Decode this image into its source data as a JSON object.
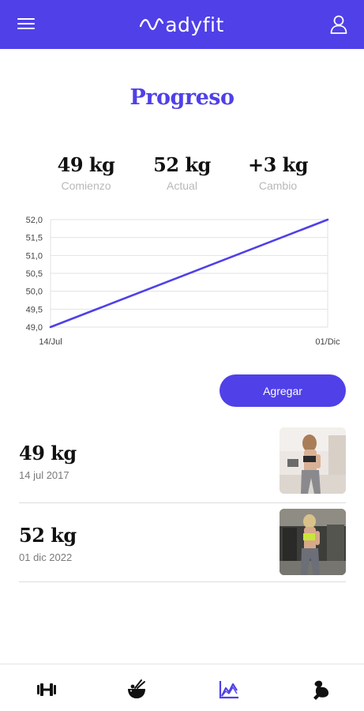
{
  "header": {
    "brand_name": "adyfit",
    "menu_icon": "hamburger-menu-icon",
    "profile_icon": "user-profile-icon",
    "brand_color": "#5040e8"
  },
  "page": {
    "title": "Progreso"
  },
  "stats": [
    {
      "value": "49 kg",
      "label": "Comienzo"
    },
    {
      "value": "52 kg",
      "label": "Actual"
    },
    {
      "value": "+3 kg",
      "label": "Cambio"
    }
  ],
  "chart_data": {
    "type": "line",
    "x": [
      "14/Jul",
      "01/Dic"
    ],
    "series": [
      {
        "values": [
          49.0,
          52.0
        ]
      }
    ],
    "y_ticks": [
      "49,0",
      "49,5",
      "50,0",
      "50,5",
      "51,0",
      "51,5",
      "52,0"
    ],
    "ylim": [
      49.0,
      52.0
    ],
    "grid": true,
    "line_color": "#5040e8"
  },
  "actions": {
    "add_label": "Agregar"
  },
  "entries": [
    {
      "weight": "49 kg",
      "date": "14 jul 2017"
    },
    {
      "weight": "52 kg",
      "date": "01 dic 2022"
    }
  ],
  "bottom_nav": [
    {
      "icon": "dumbbell-icon",
      "active": false
    },
    {
      "icon": "food-bowl-icon",
      "active": false
    },
    {
      "icon": "progress-chart-icon",
      "active": true
    },
    {
      "icon": "flexed-arm-icon",
      "active": false
    }
  ]
}
